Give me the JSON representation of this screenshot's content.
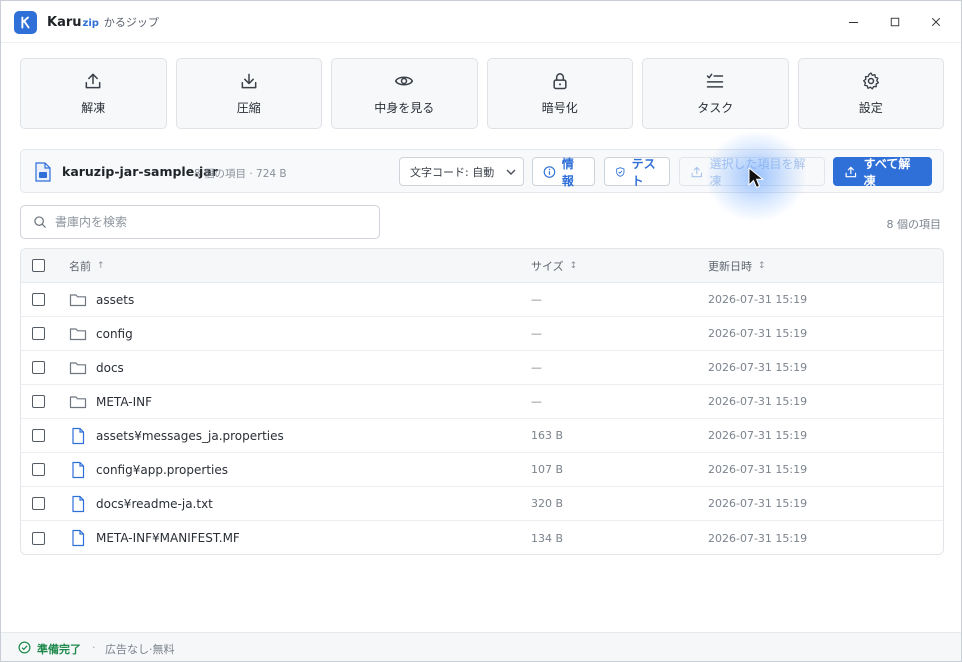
{
  "window": {
    "app_name": "Karu",
    "app_name_suffix": "zip",
    "app_name_kana": "かるジップ",
    "controls": {
      "minimize": "—",
      "maximize": "☐",
      "close": "✕"
    }
  },
  "toolbar": {
    "items": [
      {
        "label": "解凍",
        "icon": "upload-icon"
      },
      {
        "label": "圧縮",
        "icon": "download-icon"
      },
      {
        "label": "中身を見る",
        "icon": "eye-icon"
      },
      {
        "label": "暗号化",
        "icon": "lock-icon"
      },
      {
        "label": "タスク",
        "icon": "checklist-icon"
      },
      {
        "label": "設定",
        "icon": "gear-icon"
      }
    ]
  },
  "archive": {
    "name": "karuzip-jar-sample.jar",
    "meta": "8 個の項目 · 724 B",
    "encoding_label": "文字コード: 自動",
    "info_label": "情報",
    "test_label": "テスト",
    "extract_selected_label": "選択した項目を解凍",
    "extract_all_label": "すべて解凍"
  },
  "search": {
    "placeholder": "書庫内を検索",
    "value": ""
  },
  "item_count": "8 個の項目",
  "table": {
    "columns": {
      "name": "名前",
      "name_sort": "↑",
      "size": "サイズ",
      "size_sort": "↕",
      "modified": "更新日時",
      "modified_sort": "↕"
    },
    "rows": [
      {
        "type": "folder",
        "name": "assets",
        "size": "—",
        "modified": "2026-07-31 15:19"
      },
      {
        "type": "folder",
        "name": "config",
        "size": "—",
        "modified": "2026-07-31 15:19"
      },
      {
        "type": "folder",
        "name": "docs",
        "size": "—",
        "modified": "2026-07-31 15:19"
      },
      {
        "type": "folder",
        "name": "META-INF",
        "size": "—",
        "modified": "2026-07-31 15:19"
      },
      {
        "type": "file",
        "name": "assets¥messages_ja.properties",
        "size": "163 B",
        "modified": "2026-07-31 15:19"
      },
      {
        "type": "file",
        "name": "config¥app.properties",
        "size": "107 B",
        "modified": "2026-07-31 15:19"
      },
      {
        "type": "file",
        "name": "docs¥readme-ja.txt",
        "size": "320 B",
        "modified": "2026-07-31 15:19"
      },
      {
        "type": "file",
        "name": "META-INF¥MANIFEST.MF",
        "size": "134 B",
        "modified": "2026-07-31 15:19"
      }
    ]
  },
  "status": {
    "text": "準備完了",
    "separator": "·",
    "extra": "広告なし·無料"
  },
  "colors": {
    "accent": "#2f6fd8",
    "status_ok": "#1f8a4c",
    "disabled_text": "#a9c3ea"
  }
}
